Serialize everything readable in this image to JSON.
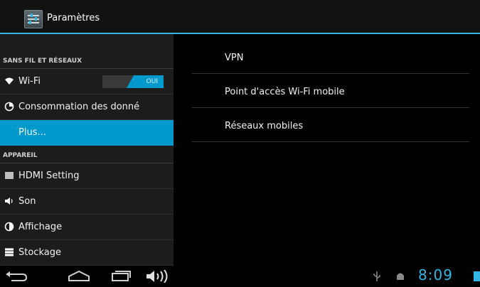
{
  "actionbar": {
    "title": "Paramètres",
    "icon": "settings-app-icon"
  },
  "left_pane": {
    "sections": [
      {
        "header": "SANS FIL ET RÉSEAUX",
        "items": [
          {
            "label": "Wi-Fi",
            "icon": "wifi-icon",
            "toggle": "OUI"
          },
          {
            "label": "Consommation des donné",
            "icon": "data-usage-icon"
          },
          {
            "label": "Plus...",
            "selected": true
          }
        ]
      },
      {
        "header": "APPAREIL",
        "items": [
          {
            "label": "HDMI Setting",
            "icon": "hdmi-icon"
          },
          {
            "label": "Son",
            "icon": "speaker-icon"
          },
          {
            "label": "Affichage",
            "icon": "display-icon"
          },
          {
            "label": "Stockage",
            "icon": "storage-icon"
          }
        ]
      }
    ]
  },
  "right_pane": {
    "items": [
      {
        "label": "VPN"
      },
      {
        "label": "Point d'accès Wi-Fi mobile"
      },
      {
        "label": "Réseaux mobiles"
      }
    ]
  },
  "navbar": {
    "buttons": [
      "back-icon",
      "home-icon",
      "recent-apps-icon",
      "volume-icon"
    ],
    "status_icons": [
      "usb-icon",
      "android-debug-icon",
      "battery-icon"
    ],
    "clock": "8:09",
    "accent": "#33b5e5"
  }
}
